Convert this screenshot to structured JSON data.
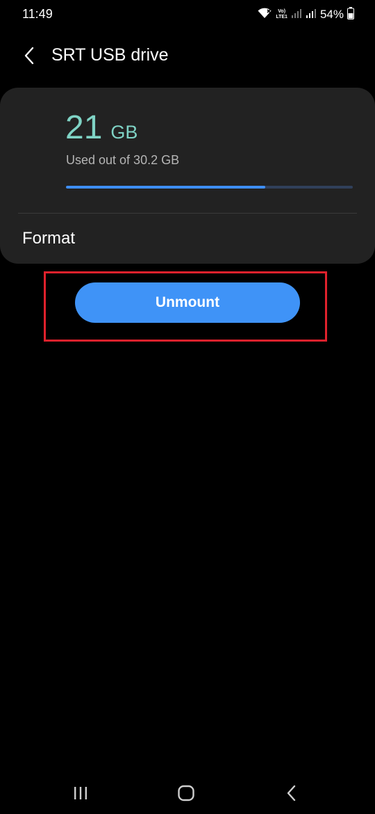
{
  "status_bar": {
    "time": "11:49",
    "battery_text": "54%",
    "volte_top": "Vo)",
    "volte_bottom": "LTE1",
    "icons": [
      "wifi-icon",
      "volte-icon",
      "signal-icon",
      "signal-icon",
      "battery-icon"
    ]
  },
  "header": {
    "title": "SRT USB drive",
    "back_icon": "chevron-left-icon"
  },
  "storage": {
    "used_number": "21",
    "used_unit": "GB",
    "caption": "Used out of 30.2 GB",
    "used_fraction": 0.695,
    "progress_color": "#3e8ef7",
    "amount_color": "#7fd3c5"
  },
  "menu": {
    "format_label": "Format"
  },
  "actions": {
    "unmount_label": "Unmount",
    "button_color": "#3f93f7",
    "highlight_color": "#e0212c"
  },
  "nav_bar": {
    "icons": [
      "recent-apps-icon",
      "home-icon",
      "back-icon"
    ]
  }
}
